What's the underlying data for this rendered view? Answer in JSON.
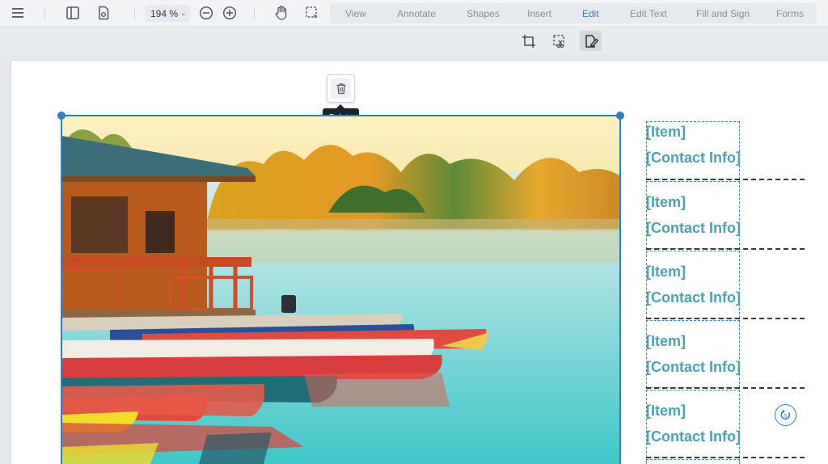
{
  "toolbar": {
    "zoom_value": "194 %",
    "icons": [
      "menu-icon",
      "sidebar-icon",
      "file-settings-icon",
      "zoom-out-icon",
      "zoom-in-icon",
      "pan-hand-icon",
      "select-icon"
    ],
    "tabs": [
      {
        "label": "View",
        "active": false
      },
      {
        "label": "Annotate",
        "active": false
      },
      {
        "label": "Shapes",
        "active": false
      },
      {
        "label": "Insert",
        "active": false
      },
      {
        "label": "Edit",
        "active": true
      },
      {
        "label": "Edit Text",
        "active": false
      },
      {
        "label": "Fill and Sign",
        "active": false
      },
      {
        "label": "Forms",
        "active": false
      }
    ]
  },
  "subtoolbar": {
    "icons": [
      "crop-icon",
      "crop-selection-icon",
      "edit-content-icon"
    ],
    "active_icon": "edit-content-icon"
  },
  "selection": {
    "delete_tooltip": "Delete"
  },
  "contacts": [
    {
      "item": "[Item]",
      "contact": "[Contact Info]"
    },
    {
      "item": "[Item]",
      "contact": "[Contact Info]"
    },
    {
      "item": "[Item]",
      "contact": "[Contact Info]"
    },
    {
      "item": "[Item]",
      "contact": "[Contact Info]"
    },
    {
      "item": "[Item]",
      "contact": "[Contact Info]"
    }
  ],
  "colors": {
    "accent": "#2f7ec6",
    "contact_text": "#4aa3b4",
    "toolbar_bg": "#f1f3f5"
  }
}
